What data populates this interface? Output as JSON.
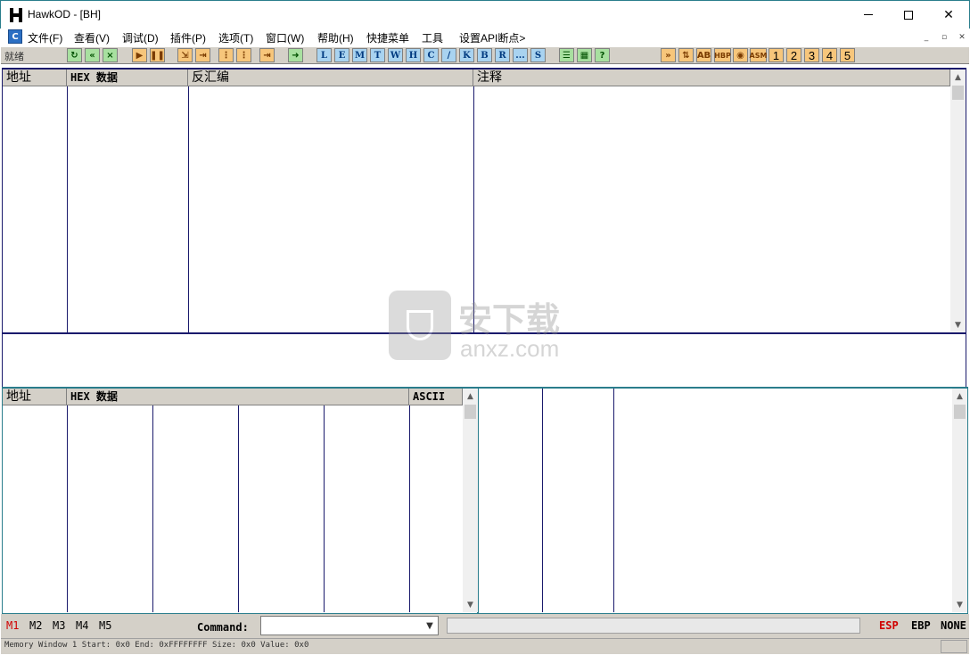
{
  "window": {
    "title": "HawkOD  - [BH]",
    "minimize_glyph": "—",
    "maximize_glyph": "☐",
    "close_glyph": "✕"
  },
  "menu": {
    "icon_letter": "C",
    "items": [
      "文件(F)",
      "查看(V)",
      "调试(D)",
      "插件(P)",
      "选项(T)",
      "窗口(W)",
      "帮助(H)",
      "快捷菜单",
      "工具",
      "设置API断点>"
    ],
    "mdi_buttons": [
      "_",
      "▫",
      "✕"
    ]
  },
  "toolbar": {
    "status": "就绪",
    "letter_buttons": [
      "L",
      "E",
      "M",
      "T",
      "W",
      "H",
      "C",
      "/",
      "K",
      "B",
      "R",
      "...",
      "S"
    ],
    "number_buttons": [
      "1",
      "2",
      "3",
      "4",
      "5"
    ],
    "tool_labels": [
      "HBP",
      "ASM"
    ]
  },
  "disasm_pane": {
    "headers": [
      "地址",
      "HEX 数据",
      "反汇编",
      "注释"
    ]
  },
  "dump_pane": {
    "headers": [
      "地址",
      "HEX 数据",
      "ASCII"
    ]
  },
  "watermark": {
    "brand": "安下载",
    "domain": "anxz.com"
  },
  "bottom": {
    "memory_tabs": [
      "M1",
      "M2",
      "M3",
      "M4",
      "M5"
    ],
    "active_tab": "M1",
    "command_label": "Command:",
    "command_value": "",
    "registers": [
      "ESP",
      "EBP",
      "NONE"
    ]
  },
  "statusbar": {
    "text": "Memory Window 1  Start: 0x0  End: 0xFFFFFFFF  Size: 0x0 Value: 0x0"
  },
  "colors": {
    "pane_border": "#1a1a6c",
    "bottom_border": "#2a7d8c",
    "toolbar_bg": "#d4d0c8",
    "active_red": "#d00000"
  }
}
